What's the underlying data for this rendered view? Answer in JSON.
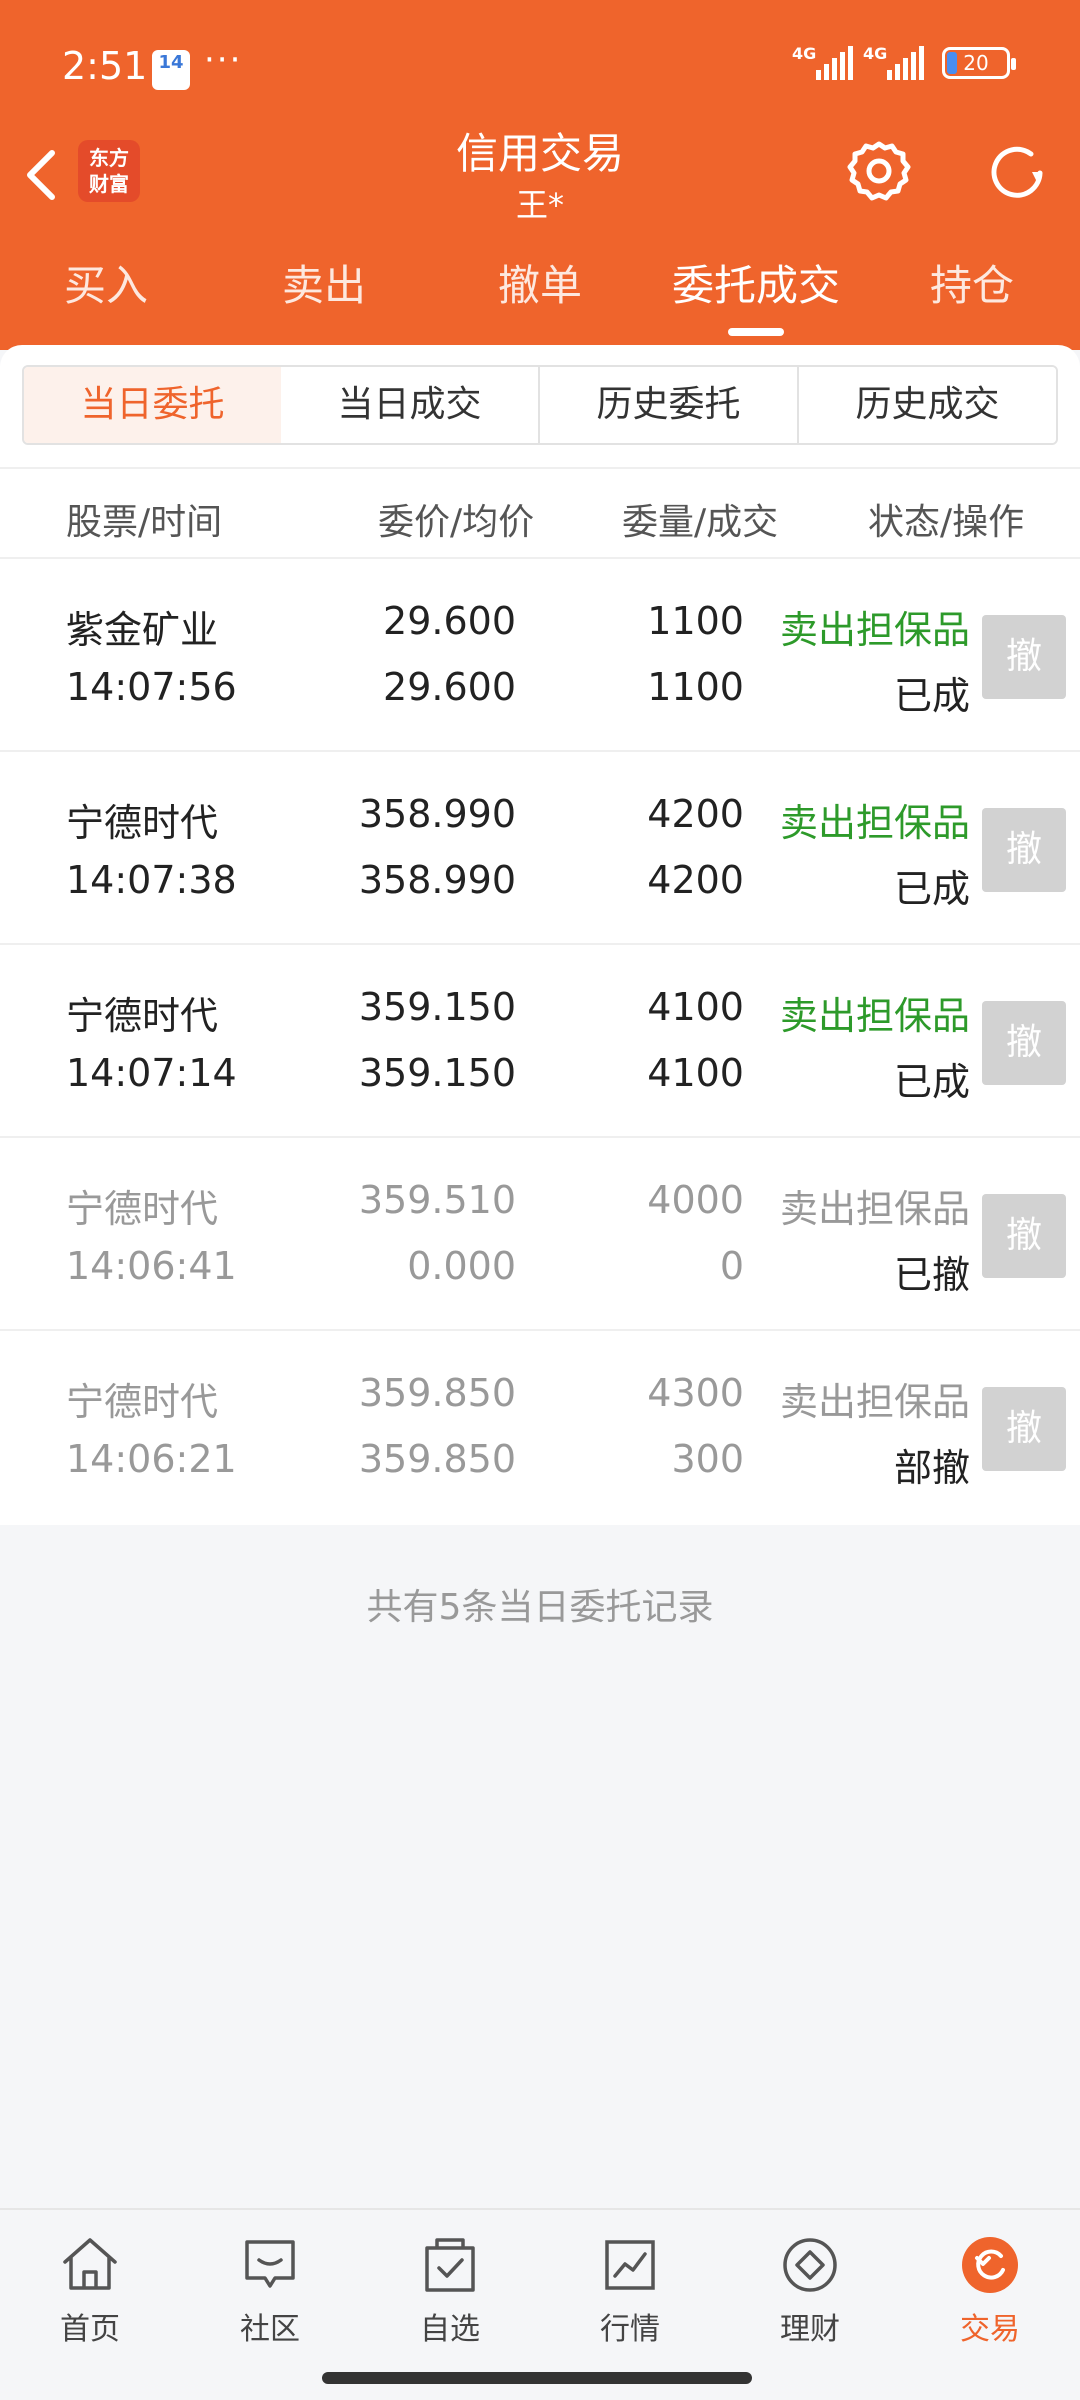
{
  "status": {
    "time": "2:51",
    "calendar_day": "14",
    "dots": "···",
    "signal1": "4G",
    "signal2": "4G",
    "battery": "20"
  },
  "header": {
    "logo": "东方\n财富",
    "title": "信用交易",
    "subtitle": "王*"
  },
  "tabs": [
    "买入",
    "卖出",
    "撤单",
    "委托成交",
    "持仓"
  ],
  "active_tab": 3,
  "segments": [
    "当日委托",
    "当日成交",
    "历史委托",
    "历史成交"
  ],
  "table": {
    "headers": [
      "股票/时间",
      "委价/均价",
      "委量/成交",
      "状态/操作"
    ],
    "rows": [
      {
        "name": "紫金矿业",
        "time": "14:07:56",
        "price": "29.600",
        "avg": "29.600",
        "qty": "1100",
        "done": "1100",
        "type": "卖出担保品",
        "status": "已成",
        "cancel": "撤"
      },
      {
        "name": "宁德时代",
        "time": "14:07:38",
        "price": "358.990",
        "avg": "358.990",
        "qty": "4200",
        "done": "4200",
        "type": "卖出担保品",
        "status": "已成",
        "cancel": "撤"
      },
      {
        "name": "宁德时代",
        "time": "14:07:14",
        "price": "359.150",
        "avg": "359.150",
        "qty": "4100",
        "done": "4100",
        "type": "卖出担保品",
        "status": "已成",
        "cancel": "撤"
      },
      {
        "name": "宁德时代",
        "time": "14:06:41",
        "price": "359.510",
        "avg": "0.000",
        "qty": "4000",
        "done": "0",
        "type": "卖出担保品",
        "status": "已撤",
        "cancel": "撤"
      },
      {
        "name": "宁德时代",
        "time": "14:06:21",
        "price": "359.850",
        "avg": "359.850",
        "qty": "4300",
        "done": "300",
        "type": "卖出担保品",
        "status": "部撤",
        "cancel": "撤"
      }
    ]
  },
  "footer_note": "共有5条当日委托记录",
  "bottom_nav": [
    "首页",
    "社区",
    "自选",
    "行情",
    "理财",
    "交易"
  ],
  "colors": {
    "brand": "#ef642c",
    "green": "#2d9a2a"
  }
}
